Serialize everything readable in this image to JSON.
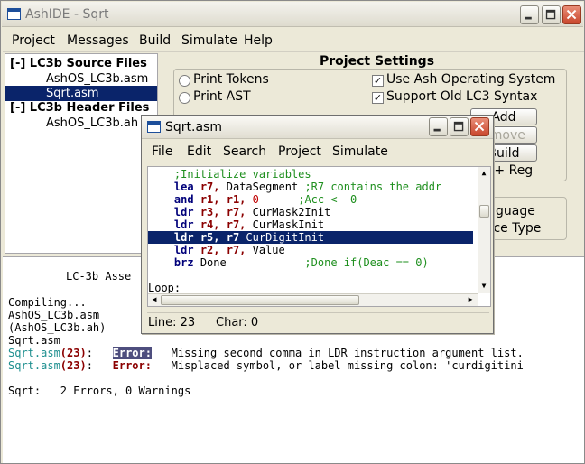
{
  "window": {
    "title": "AshIDE - Sqrt"
  },
  "menubar": [
    "Project",
    "Messages",
    "Build",
    "Simulate",
    "Help"
  ],
  "tree": {
    "source_header": "[-]  LC3b Source Files",
    "source_items": [
      "AshOS_LC3b.asm",
      "Sqrt.asm"
    ],
    "header_header": "[-]  LC3b Header Files",
    "header_items": [
      "AshOS_LC3b.ah"
    ]
  },
  "settings": {
    "title": "Project Settings",
    "print_tokens": "Print Tokens",
    "print_ast": "Print AST",
    "use_ash_os": "Use Ash Operating System",
    "support_old": "Support Old LC3 Syntax",
    "add_button": "Add",
    "remove_button": "emove",
    "build_button": "Build",
    "dis_reg_button": "Dis + Reg",
    "language_label": "guage",
    "source_type_label": "rce Type"
  },
  "editor_window": {
    "title": "Sqrt.asm",
    "menu": [
      "File",
      "Edit",
      "Search",
      "Project",
      "Simulate"
    ],
    "status_line": "Line: 23",
    "status_char": "Char: 0",
    "code": {
      "l1_comment": ";Initialize variables",
      "l2_op": "lea",
      "l2_reg": "r7,",
      "l2_arg": " DataSegment ",
      "l2_comment": ";R7 contains the addr",
      "l3_op": "and",
      "l3_regs": "r1, r1,",
      "l3_num": "0",
      "l3_comment": ";Acc <- 0",
      "l4_op": "ldr",
      "l4_regs": "r3, r7,",
      "l4_arg": " CurMask2Init",
      "l5_op": "ldr",
      "l5_regs": "r4, r7,",
      "l5_arg": " CurMaskInit",
      "l6_op": "ldr",
      "l6_regs": "r5, r7",
      "l6_arg": " CurDigitInit",
      "l7_op": "ldr",
      "l7_regs": "r2, r7,",
      "l7_arg": " Value",
      "l8_op": "brz",
      "l8_arg": " Done",
      "l8_comment": ";Done if(Deac == 0)",
      "l9_label": "Loop:"
    }
  },
  "console": {
    "line1": "LC-3b Asse",
    "line2": "Compiling...",
    "line3": "AshOS_LC3b.asm",
    "line4": "(AshOS_LC3b.ah)",
    "line5": "Sqrt.asm",
    "err1_file": "Sqrt.asm",
    "err1_num": "(23)",
    "err1_colon": ":",
    "err1_tag": "Error:",
    "err1_msg": "Missing second comma in LDR instruction argument list.",
    "err2_file": "Sqrt.asm",
    "err2_num": "(23)",
    "err2_colon": ":",
    "err2_tag": "Error:",
    "err2_msg": "Misplaced symbol, or label missing colon: 'curdigitini",
    "summary": "Sqrt:   2 Errors, 0 Warnings"
  }
}
